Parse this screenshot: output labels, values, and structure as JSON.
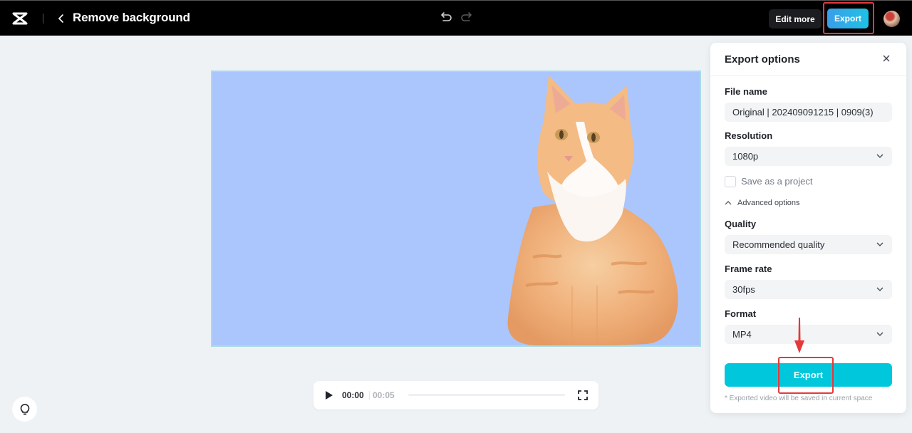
{
  "header": {
    "logo_icon": "capcut-logo-icon",
    "back_icon": "chevron-left-icon",
    "title": "Remove background",
    "undo_icon": "undo-icon",
    "redo_icon": "redo-icon",
    "edit_more_label": "Edit more",
    "export_label": "Export",
    "avatar_icon": "user-avatar"
  },
  "preview": {
    "background_color": "#abc6fd",
    "subject": "orange tabby cat (background removed)"
  },
  "player": {
    "current_time": "00:00",
    "total_time": "00:05",
    "progress": 0,
    "play_icon": "play-icon",
    "fullscreen_icon": "fullscreen-icon"
  },
  "hint_icon": "lightbulb-icon",
  "export_panel": {
    "title": "Export options",
    "close_icon": "close-icon",
    "file_name_label": "File name",
    "file_name_value": "Original | 202409091215 | 0909(3)",
    "resolution_label": "Resolution",
    "resolution_value": "1080p",
    "save_project_label": "Save as a project",
    "save_project_checked": false,
    "advanced_label": "Advanced options",
    "quality_label": "Quality",
    "quality_value": "Recommended quality",
    "frame_rate_label": "Frame rate",
    "frame_rate_value": "30fps",
    "format_label": "Format",
    "format_value": "MP4",
    "export_button_label": "Export",
    "footnote": "* Exported video will be saved in current space"
  },
  "colors": {
    "accent": "#00c7dc",
    "highlight": "#e5393b",
    "topbar": "#000000"
  }
}
